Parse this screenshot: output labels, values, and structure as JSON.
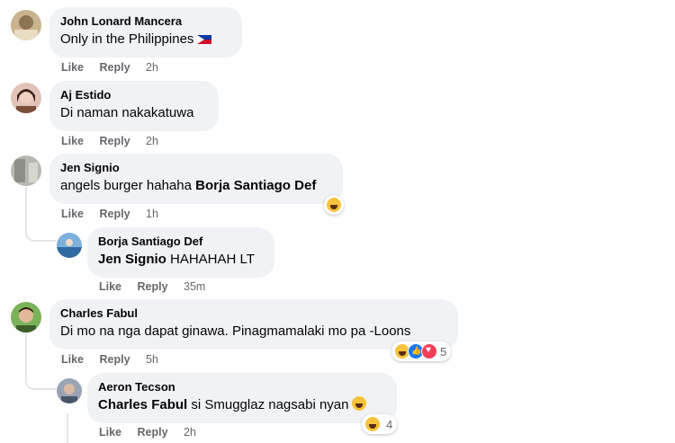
{
  "comments": [
    {
      "author": "John Lonard Mancera",
      "text": "Only in the Philippines",
      "flag": "philippines-flag",
      "like": "Like",
      "reply": "Reply",
      "time": "2h",
      "avatar_color": "#b9a27a"
    },
    {
      "author": "Aj Estido",
      "text": "Di naman nakakatuwa",
      "like": "Like",
      "reply": "Reply",
      "time": "2h",
      "avatar_color": "#c99a8a"
    },
    {
      "author": "Jen Signio",
      "text": "angels burger hahaha ",
      "mention": "Borja Santiago Def",
      "like": "Like",
      "reply": "Reply",
      "time": "1h",
      "reaction": "haha",
      "avatar_color": "#a8a8a0"
    },
    {
      "author": "Borja Santiago Def",
      "mention": "Jen Signio",
      "text": " HAHAHAH LT",
      "like": "Like",
      "reply": "Reply",
      "time": "35m",
      "avatar_color": "#5a8fc4"
    },
    {
      "author": "Charles Fabul",
      "text": "Di mo na nga dapat ginawa. Pinagmamalaki mo pa -Loons",
      "like": "Like",
      "reply": "Reply",
      "time": "5h",
      "reactions": [
        "haha",
        "like",
        "love"
      ],
      "reaction_count": "5",
      "avatar_color": "#5e9a3f"
    },
    {
      "author": "Aeron Tecson",
      "mention": "Charles Fabul",
      "text": " si Smugglaz nagsabi nyan",
      "like": "Like",
      "reply": "Reply",
      "time": "2h",
      "reaction": "haha",
      "reaction_count": "4",
      "avatar_color": "#8a94a6"
    }
  ]
}
